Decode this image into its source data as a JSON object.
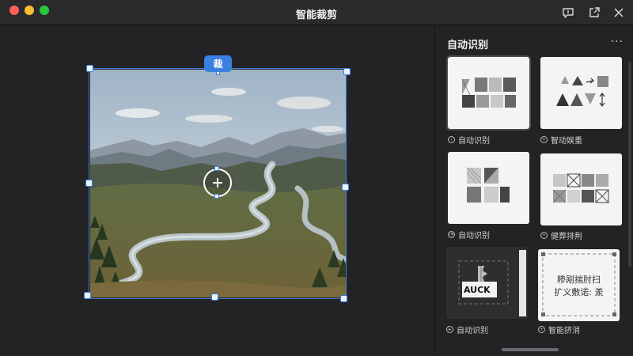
{
  "window": {
    "title": "智能裁剪"
  },
  "toolbar": {
    "icons": [
      "feedback-icon",
      "share-icon",
      "close-icon"
    ]
  },
  "editor": {
    "crop_badge": "裁",
    "crop_badge_icon": "crop-icon",
    "center_icon": "plus-icon",
    "accent_color": "#3b7fe0"
  },
  "sidebar": {
    "title": "自动识别",
    "more": "···",
    "cards": [
      {
        "label": "自动识别",
        "icon": "circle-arrow-icon"
      },
      {
        "label": "智动娱重",
        "icon": "circle-plus-icon"
      },
      {
        "label": "自动识别",
        "icon": "circle-clock-icon"
      },
      {
        "label": "健葬排荆",
        "icon": "circle-plus-icon"
      },
      {
        "label": "自动识别",
        "icon": "circle-play-icon",
        "preview_text": "AUCK"
      },
      {
        "label": "智能挤消",
        "icon": "circle-plus-icon",
        "preview_lines": [
          "糁剐揣肘扫",
          "扩义敷诺: 羕"
        ]
      }
    ]
  }
}
